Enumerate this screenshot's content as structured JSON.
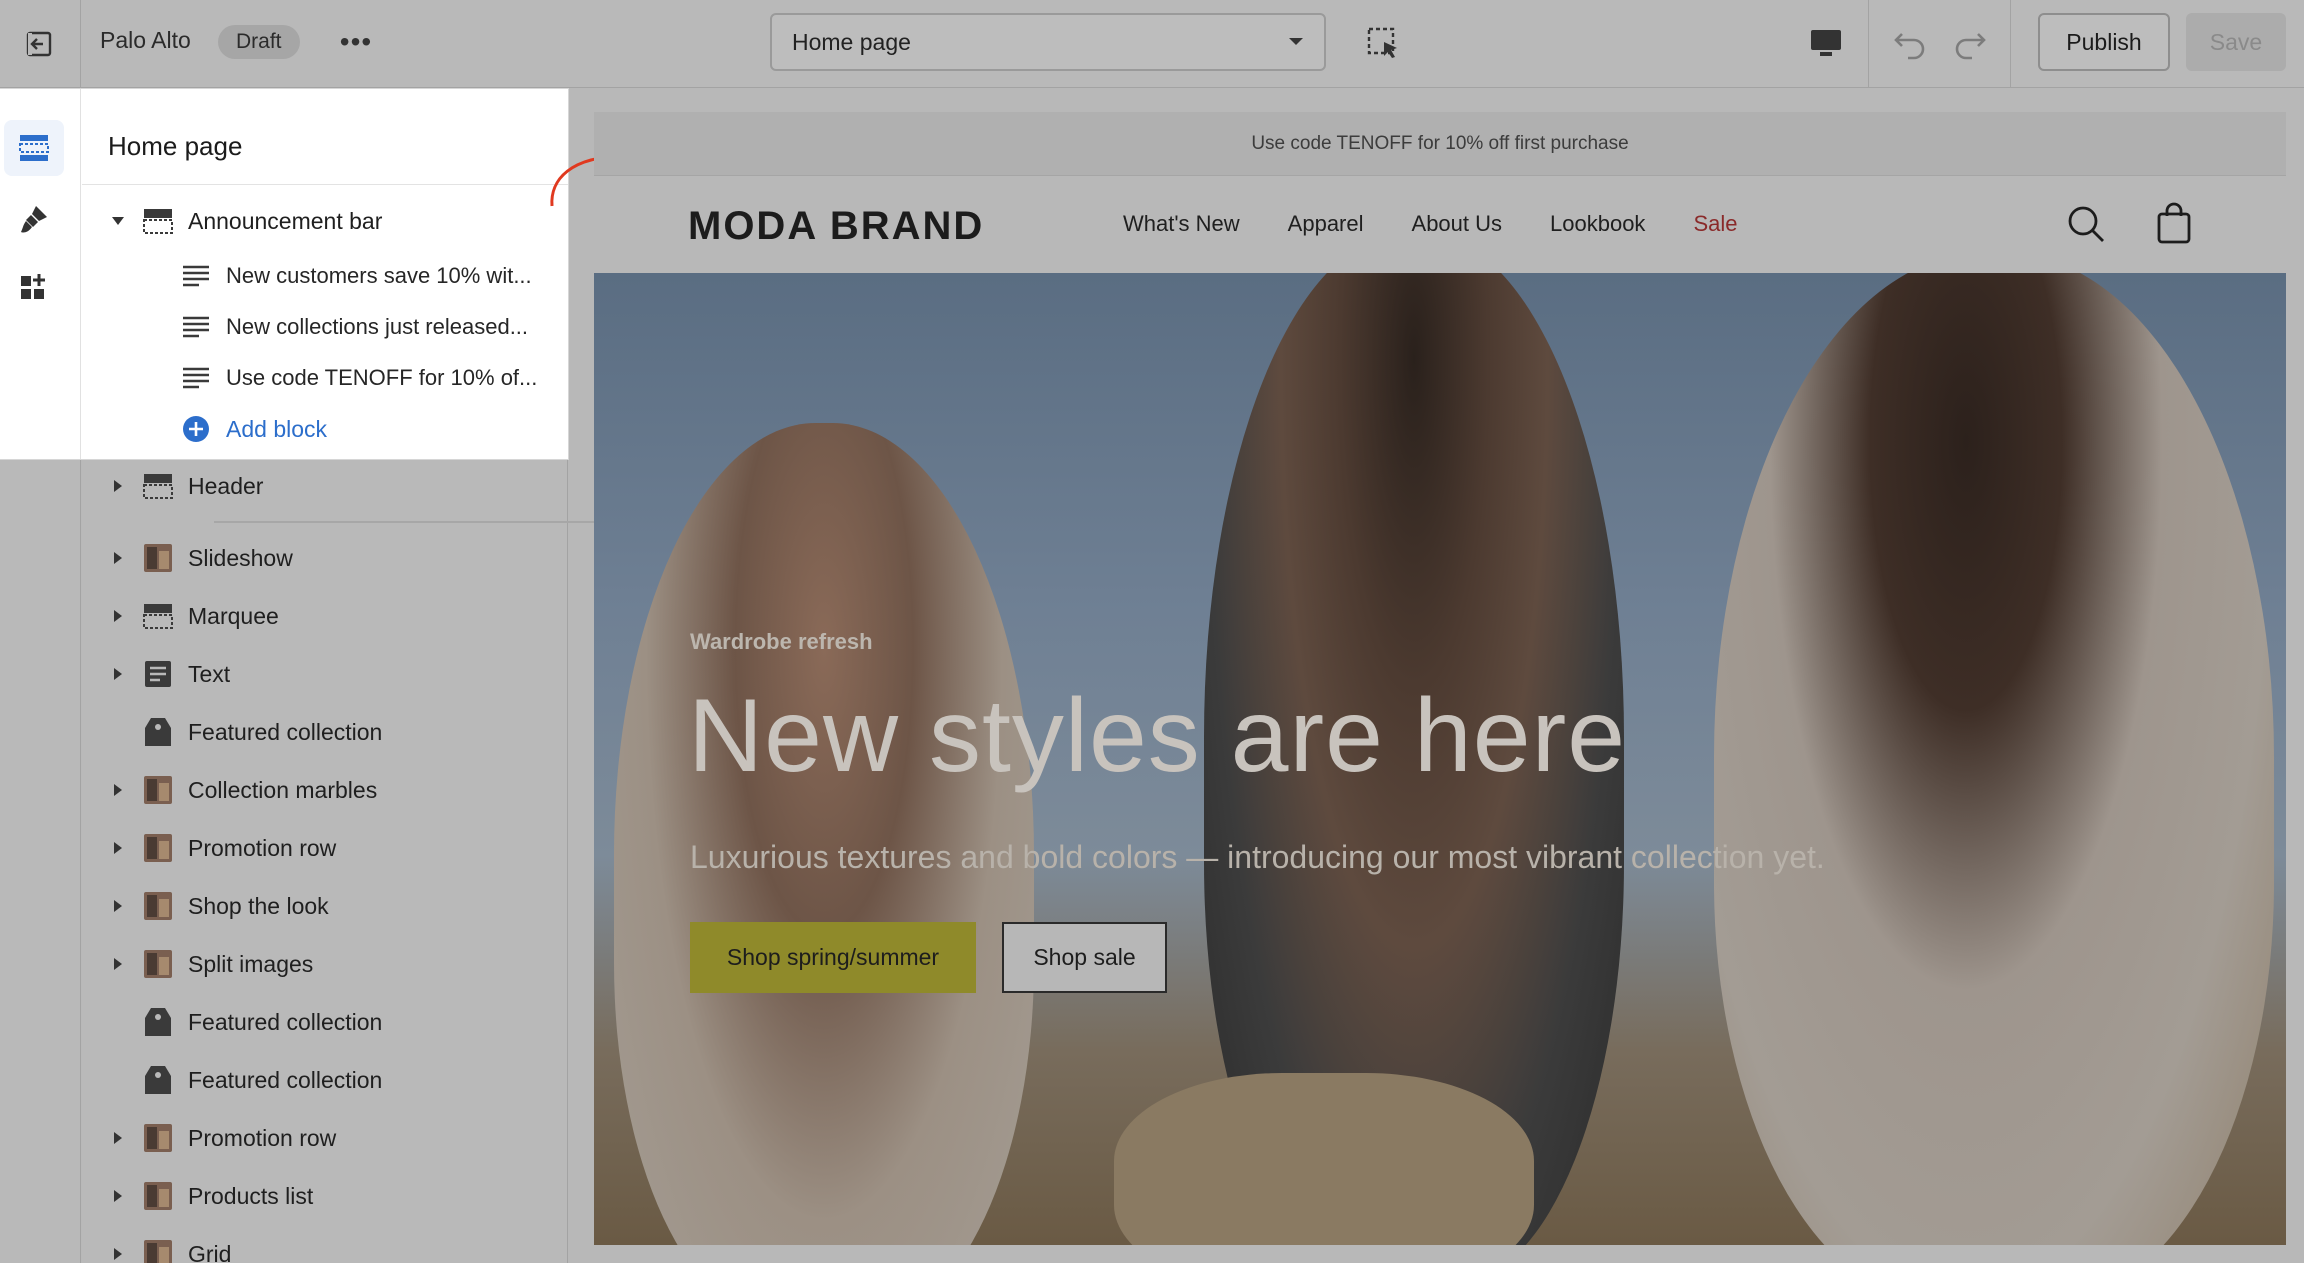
{
  "topbar": {
    "store_name": "Palo Alto",
    "status_badge": "Draft",
    "more_label": "•••",
    "page_select_value": "Home page",
    "publish_label": "Publish",
    "save_label": "Save"
  },
  "panel": {
    "title": "Home page",
    "announcement": {
      "label": "Announcement bar",
      "blocks": [
        "New customers save 10% wit...",
        "New collections just released...",
        "Use code TENOFF for 10% of..."
      ],
      "add_block_label": "Add block"
    },
    "sections": [
      {
        "label": "Header",
        "caret": true,
        "icon": "layout-icon"
      },
      {
        "label": "Slideshow",
        "caret": true,
        "icon": "image-thumb-icon"
      },
      {
        "label": "Marquee",
        "caret": true,
        "icon": "layout-icon"
      },
      {
        "label": "Text",
        "caret": true,
        "icon": "text-icon"
      },
      {
        "label": "Featured collection",
        "caret": false,
        "icon": "tag-icon"
      },
      {
        "label": "Collection marbles",
        "caret": true,
        "icon": "image-thumb-icon"
      },
      {
        "label": "Promotion row",
        "caret": true,
        "icon": "image-thumb-icon"
      },
      {
        "label": "Shop the look",
        "caret": true,
        "icon": "image-thumb-icon"
      },
      {
        "label": "Split images",
        "caret": true,
        "icon": "image-thumb-icon"
      },
      {
        "label": "Featured collection",
        "caret": false,
        "icon": "tag-icon"
      },
      {
        "label": "Featured collection",
        "caret": false,
        "icon": "tag-icon"
      },
      {
        "label": "Promotion row",
        "caret": true,
        "icon": "image-thumb-icon"
      },
      {
        "label": "Products list",
        "caret": true,
        "icon": "image-thumb-icon"
      },
      {
        "label": "Grid",
        "caret": true,
        "icon": "image-thumb-icon"
      }
    ]
  },
  "preview": {
    "announcement_text": "Use code TENOFF for 10% off first purchase",
    "brand": "MODA BRAND",
    "nav": [
      "What's New",
      "Apparel",
      "About Us",
      "Lookbook",
      "Sale"
    ],
    "hero": {
      "eyebrow": "Wardrobe refresh",
      "title": "New styles are here",
      "subtitle": "Luxurious textures and bold colors — introducing our most vibrant collection yet.",
      "primary_cta": "Shop spring/summer",
      "secondary_cta": "Shop sale"
    }
  },
  "colors": {
    "accent_blue": "#2c6ecb",
    "highlight_arrow": "#e0391f",
    "sale_red": "#8a2a2a",
    "cta_primary": "#8f8a2a"
  }
}
